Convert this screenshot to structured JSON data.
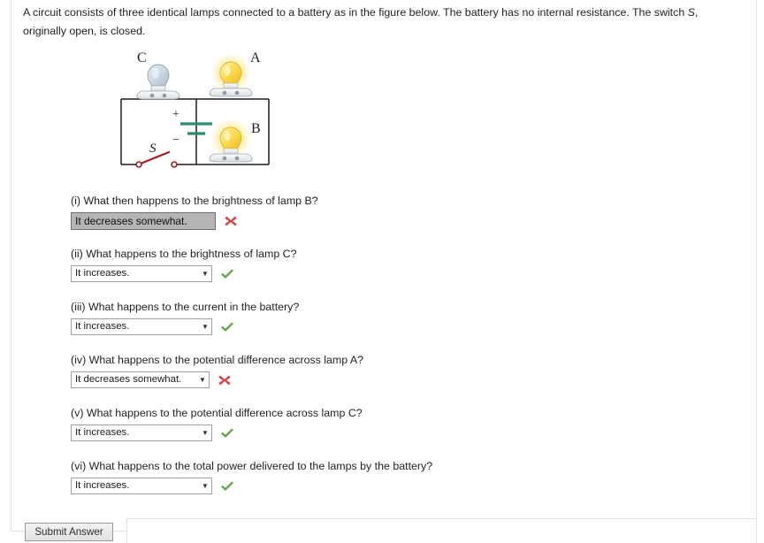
{
  "prompt": {
    "line1_a": "A circuit consists of three identical lamps connected to a battery as in the figure below. The battery has no internal",
    "line2_a": "resistance. The switch ",
    "line2_switch": "S",
    "line2_b": ", originally open, is closed."
  },
  "figure": {
    "name": "circuit-diagram",
    "lamp_c_label": "C",
    "lamp_a_label": "A",
    "lamp_b_label": "B",
    "switch_label": "S",
    "battery_plus": "+",
    "battery_minus": "−",
    "colors": {
      "wire": "#1a1a1a",
      "battery": "#2e8b6b",
      "switch": "#a61c23",
      "lamp_lit": "#f5c518",
      "lamp_unlit": "#c3cfdb"
    },
    "lamp_states": {
      "A": "lit",
      "B": "lit",
      "C": "unlit"
    }
  },
  "questions": [
    {
      "number": "(i)",
      "text": "(i) What then happens to the brightness of lamp B?",
      "answer": "It decreases somewhat.",
      "state": "focused",
      "verdict": "incorrect"
    },
    {
      "number": "(ii)",
      "text": "(ii) What happens to the brightness of lamp C?",
      "answer": "It increases.",
      "state": "closed",
      "verdict": "correct"
    },
    {
      "number": "(iii)",
      "text": "(iii) What happens to the current in the battery?",
      "answer": "It increases.",
      "state": "closed",
      "verdict": "correct"
    },
    {
      "number": "(iv)",
      "text": "(iv) What happens to the potential difference across lamp A?",
      "answer": "It decreases somewhat.",
      "state": "closed",
      "verdict": "incorrect"
    },
    {
      "number": "(v)",
      "text": "(v) What happens to the potential difference across lamp C?",
      "answer": "It increases.",
      "state": "closed",
      "verdict": "correct"
    },
    {
      "number": "(vi)",
      "text": "(vi) What happens to the total power delivered to the lamps by the battery?",
      "answer": "It increases.",
      "state": "closed",
      "verdict": "correct"
    }
  ],
  "footer": {
    "submit_label": "Submit Answer"
  },
  "colors": {
    "correct": "#6aa84f",
    "incorrect": "#d8403f",
    "text": "#231f20"
  }
}
